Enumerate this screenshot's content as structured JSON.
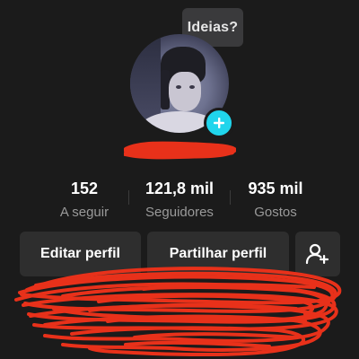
{
  "ideas_bubble": {
    "label": "Ideias?"
  },
  "profile": {
    "avatar_alt": "profile photo",
    "username": ""
  },
  "stats": [
    {
      "value": "152",
      "label": "A seguir"
    },
    {
      "value": "121,8 mil",
      "label": "Seguidores"
    },
    {
      "value": "935 mil",
      "label": "Gostos"
    }
  ],
  "actions": {
    "edit_profile": "Editar perfil",
    "share_profile": "Partilhar perfil",
    "add_friend_icon": "person-add-icon"
  },
  "colors": {
    "background": "#1b1b1b",
    "button_bg": "#2e2e2e",
    "add_badge": "#20d5ec",
    "scribble": "#e8311a",
    "muted_text": "#9a9a9a"
  }
}
